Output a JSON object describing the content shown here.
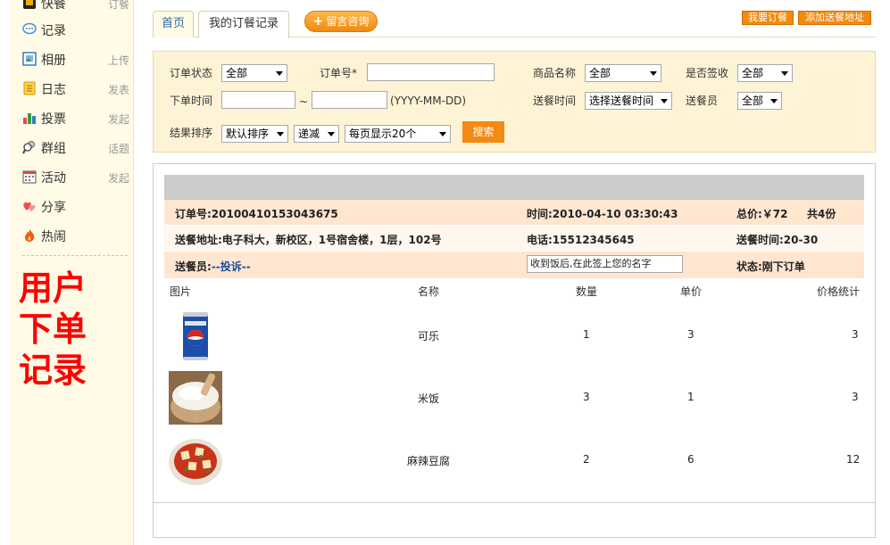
{
  "sidebar": {
    "items": [
      {
        "label": "快餐",
        "action": "订餐",
        "icon": "fast-food-icon"
      },
      {
        "label": "记录",
        "action": "",
        "icon": "chat-bubble-icon"
      },
      {
        "label": "相册",
        "action": "上传",
        "icon": "photo-album-icon"
      },
      {
        "label": "日志",
        "action": "发表",
        "icon": "notebook-icon"
      },
      {
        "label": "投票",
        "action": "发起",
        "icon": "bar-chart-icon"
      },
      {
        "label": "群组",
        "action": "话题",
        "icon": "group-icon"
      },
      {
        "label": "活动",
        "action": "发起",
        "icon": "calendar-icon"
      },
      {
        "label": "分享",
        "action": "",
        "icon": "hearts-icon"
      },
      {
        "label": "热闹",
        "action": "",
        "icon": "fire-icon"
      }
    ],
    "promo_lines": [
      "用户",
      "下单",
      "记录"
    ]
  },
  "tabs": {
    "home": "首页",
    "orders": "我的订餐记录"
  },
  "toolbar": {
    "consult_label": "留言咨询",
    "order_meal_label": "我要订餐",
    "add_address_label": "添加送餐地址"
  },
  "filters": {
    "order_status_label": "订单状态",
    "order_status_value": "全部",
    "order_no_label": "订单号*",
    "order_no_value": "",
    "product_name_label": "商品名称",
    "product_name_value": "全部",
    "signed_label": "是否签收",
    "signed_value": "全部",
    "order_time_label": "下单时间",
    "date_sep": "~",
    "date_format": "(YYYY-MM-DD)",
    "delivery_time_label": "送餐时间",
    "delivery_time_value": "选择送餐时间",
    "courier_label": "送餐员",
    "courier_value": "全部",
    "sort_label": "结果排序",
    "sort_value": "默认排序",
    "sort_dir_value": "递减",
    "page_size_value": "每页显示20个",
    "search_label": "搜索"
  },
  "order": {
    "order_no": "订单号:20100410153043675",
    "time": "时间:2010-04-10 03:30:43",
    "total": "总价:￥72",
    "count": "共4份",
    "address": "送餐地址:电子科大，新校区，1号宿舍楼，1层，102号",
    "phone": "电话:15512345645",
    "delivery_time": "送餐时间:20-30",
    "courier_prefix": "送餐员:",
    "courier_link": "--投诉--",
    "sign_note": "收到饭后,在此签上您的名字",
    "status": "状态:刚下订单"
  },
  "table": {
    "headers": [
      "图片",
      "名称",
      "数量",
      "单价",
      "价格统计"
    ],
    "rows": [
      {
        "name": "可乐",
        "qty": "1",
        "price": "3",
        "subtotal": "3",
        "image": "cola-can-image"
      },
      {
        "name": "米饭",
        "qty": "3",
        "price": "1",
        "subtotal": "3",
        "image": "rice-bowl-image"
      },
      {
        "name": "麻辣豆腐",
        "qty": "2",
        "price": "6",
        "subtotal": "12",
        "image": "mapo-tofu-image"
      }
    ]
  },
  "colors": {
    "accent_orange": "#f58a12",
    "promo_red": "#ff0000",
    "sidebar_bg": "#fffbe6",
    "filter_bg": "#fff3d6",
    "row_highlight": "#ffe6d0"
  }
}
